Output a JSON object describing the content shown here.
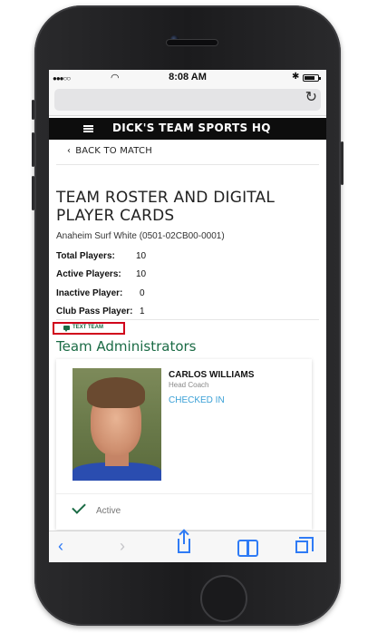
{
  "status_bar": {
    "signal": "●●●○○",
    "time": "8:08 AM",
    "battery_level": 0.8
  },
  "site_header": {
    "brand": "DICK'S TEAM SPORTS HQ"
  },
  "nav": {
    "back_label": "BACK TO MATCH"
  },
  "page": {
    "title": "TEAM ROSTER AND DIGITAL PLAYER CARDS",
    "team_name": "Anaheim Surf White (0501-02CB00-0001)"
  },
  "stats": [
    {
      "label": "Total Players:",
      "value": "10"
    },
    {
      "label": "Active Players:",
      "value": "10"
    },
    {
      "label": "Inactive Player:",
      "value": "0"
    },
    {
      "label": "Club Pass Player:",
      "value": "1"
    }
  ],
  "text_team": {
    "label": "TEXT TEAM"
  },
  "admins_heading": "Team Administrators",
  "admin_card": {
    "name": "CARLOS WILLIAMS",
    "role": "Head Coach",
    "status": "CHECKED IN",
    "active_label": "Active"
  },
  "colors": {
    "accent_green": "#1b6b45",
    "highlight_red": "#d0021b",
    "link_blue": "#3aa0d6",
    "safari_blue": "#2f7bf5"
  }
}
